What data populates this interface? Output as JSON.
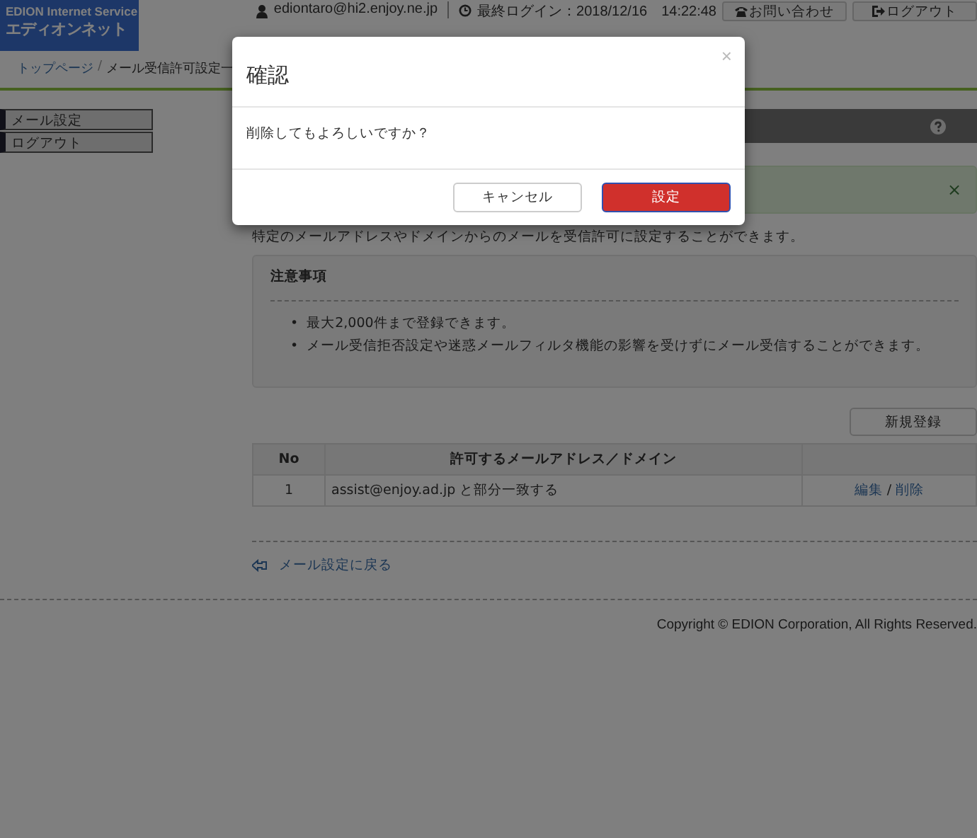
{
  "header": {
    "logo": {
      "line1": "EDION Internet Service",
      "line2": "エディオンネット"
    },
    "user": "ediontaro@hi2.enjoy.ne.jp",
    "last_login": "最終ログイン：2018/12/16　14:22:48",
    "buttons": [
      {
        "label": "お問い合わせ",
        "kind": "contact"
      },
      {
        "label": "ログアウト",
        "kind": "logout"
      }
    ]
  },
  "breadcrumb": {
    "items": [
      "トップページ",
      "メール受信許可設定一"
    ],
    "separator": "/"
  },
  "sidebar": {
    "items": [
      "メール設定",
      "ログアウト"
    ]
  },
  "description": "特定のメールアドレスやドメインからのメールを受信許可に設定することができます。",
  "notes": {
    "title": "注意事項",
    "bullet": "•",
    "items": [
      "最大2,000件まで登録できます。",
      "メール受信拒否設定や迷惑メールフィルタ機能の影響を受けずにメール受信することができます。"
    ]
  },
  "new_button": "新規登録",
  "table": {
    "columns": [
      "No",
      "許可するメールアドレス／ドメイン"
    ],
    "rows": [
      {
        "no": "1",
        "address": "assist@enjoy.ad.jp と部分一致する",
        "edit": "編集",
        "separator": "/",
        "delete": "削除"
      }
    ]
  },
  "back_link": "メール設定に戻る",
  "copyright": "Copyright © EDION Corporation, All Rights Reserved.",
  "modal": {
    "title": "確認",
    "close": "×",
    "message": "削除してもよろしいですか？",
    "buttons": [
      {
        "label": "キャンセル",
        "kind": "cancel"
      },
      {
        "label": "設定",
        "kind": "primary"
      }
    ]
  },
  "alert": {
    "close": "×"
  }
}
